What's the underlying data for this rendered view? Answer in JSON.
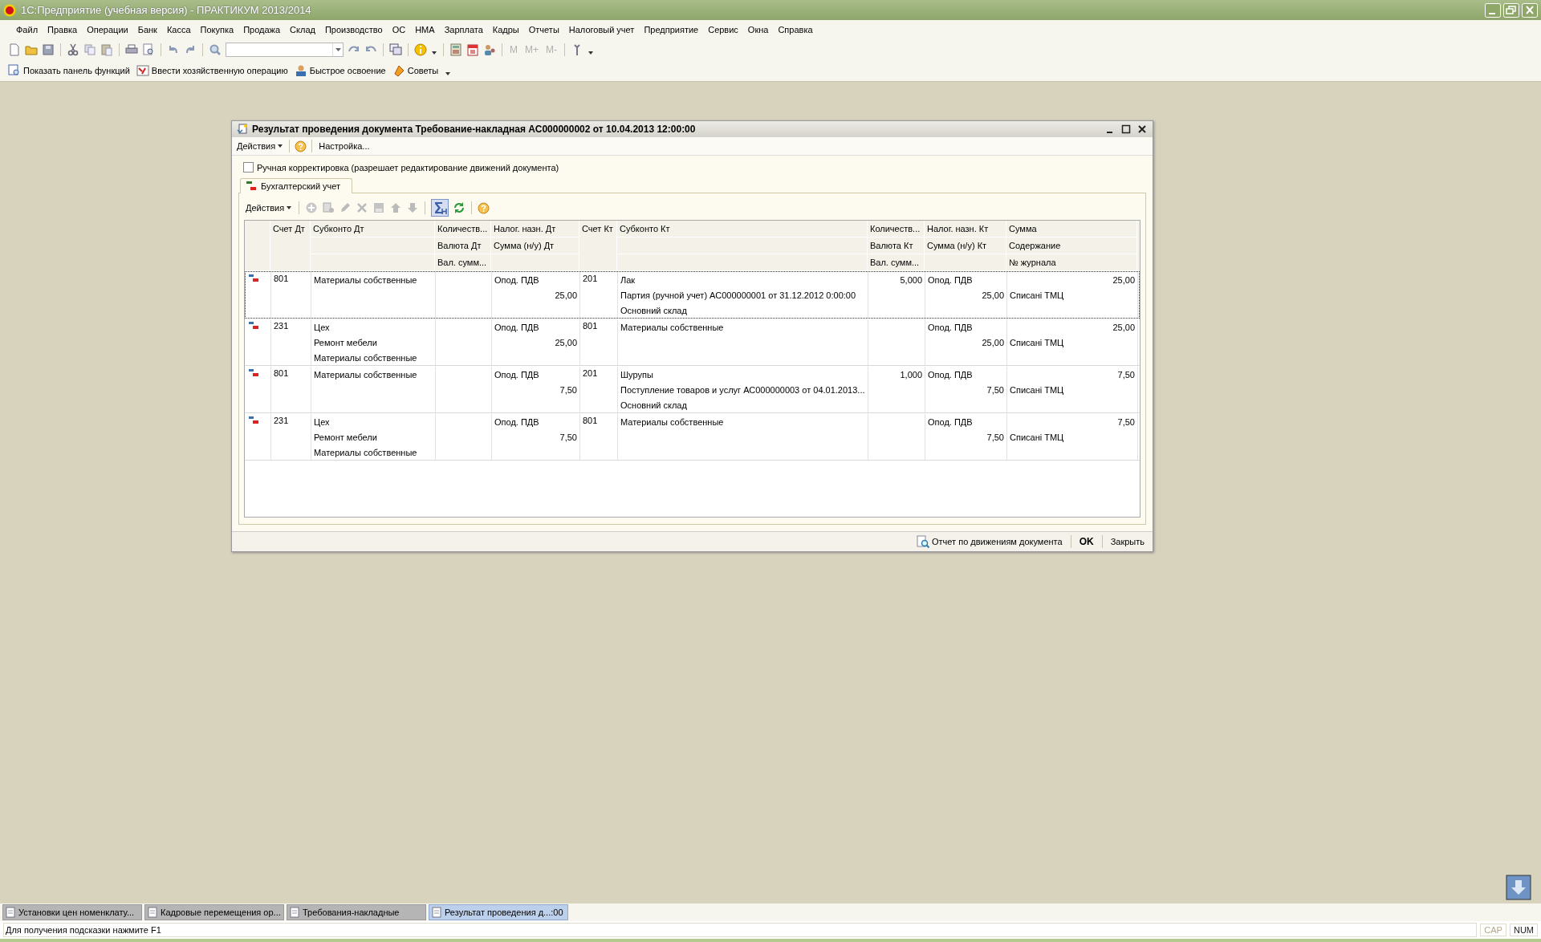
{
  "window": {
    "title": "1С:Предприятие (учебная версия) - ПРАКТИКУМ 2013/2014"
  },
  "menu": [
    "Файл",
    "Правка",
    "Операции",
    "Банк",
    "Касса",
    "Покупка",
    "Продажа",
    "Склад",
    "Производство",
    "ОС",
    "НМА",
    "Зарплата",
    "Кадры",
    "Отчеты",
    "Налоговый учет",
    "Предприятие",
    "Сервис",
    "Окна",
    "Справка"
  ],
  "toolbar": {
    "memory_buttons": [
      {
        "label": "M",
        "disabled": true
      },
      {
        "label": "M+",
        "disabled": true
      },
      {
        "label": "M-",
        "disabled": true
      }
    ]
  },
  "quick_bar": [
    "Показать панель функций",
    "Ввести хозяйственную операцию",
    "Быстрое освоение",
    "Советы"
  ],
  "dialog": {
    "title": "Результат проведения документа Требование-накладная АС000000002 от 10.04.2013 12:00:00",
    "menu": {
      "actions": "Действия",
      "settings": "Настройка..."
    },
    "manual_edit": {
      "label": "Ручная корректировка (разрешает редактирование движений документа)",
      "checked": false
    },
    "tabs": [
      {
        "label": "Бухгалтерский учет",
        "selected": true
      }
    ],
    "table_toolbar": {
      "actions": "Действия",
      "totals_on": true
    },
    "columns": [
      {
        "kind": "icon"
      },
      {
        "kind": "single",
        "lines": [
          "Счет Дт"
        ]
      },
      {
        "kind": "stacked",
        "lines": [
          "Субконто Дт"
        ]
      },
      {
        "kind": "stacked",
        "lines": [
          "Количеств...",
          "Валюта Дт",
          "Вал. сумм..."
        ]
      },
      {
        "kind": "stacked",
        "lines": [
          "Налог. назн. Дт",
          "Сумма (н/у) Дт"
        ]
      },
      {
        "kind": "single",
        "lines": [
          "Счет Кт"
        ]
      },
      {
        "kind": "stacked",
        "lines": [
          "Субконто Кт"
        ]
      },
      {
        "kind": "stacked",
        "lines": [
          "Количеств...",
          "Валюта Кт",
          "Вал. сумм..."
        ]
      },
      {
        "kind": "stacked",
        "lines": [
          "Налог. назн. Кт",
          "Сумма (н/у) Кт"
        ]
      },
      {
        "kind": "stacked",
        "lines": [
          "Сумма",
          "Содержание",
          "№ журнала"
        ]
      }
    ],
    "rows": [
      {
        "selected": true,
        "cells": {
          "account_dt": [
            "801"
          ],
          "subconto_dt": [
            "Материалы собственные"
          ],
          "tax_dt": [
            "Опод. ПДВ",
            "25,00"
          ],
          "account_kt": [
            "201"
          ],
          "subconto_kt": [
            "Лак",
            "Партия (ручной учет) АС000000001 от 31.12.2012 0:00:00",
            "Основний склад"
          ],
          "quantity_kt": [
            "5,000"
          ],
          "tax_kt": [
            "Опод. ПДВ",
            "25,00"
          ],
          "sum": [
            "25,00",
            "Списані ТМЦ"
          ]
        }
      },
      {
        "selected": false,
        "cells": {
          "account_dt": [
            "231"
          ],
          "subconto_dt": [
            "Цех",
            "Ремонт мебели",
            "Материалы собственные"
          ],
          "tax_dt": [
            "Опод. ПДВ",
            "25,00"
          ],
          "account_kt": [
            "801"
          ],
          "subconto_kt": [
            "Материалы собственные"
          ],
          "tax_kt": [
            "Опод. ПДВ",
            "25,00"
          ],
          "sum": [
            "25,00",
            "Списані ТМЦ"
          ]
        }
      },
      {
        "selected": false,
        "cells": {
          "account_dt": [
            "801"
          ],
          "subconto_dt": [
            "Материалы собственные"
          ],
          "tax_dt": [
            "Опод. ПДВ",
            "7,50"
          ],
          "account_kt": [
            "201"
          ],
          "subconto_kt": [
            "Шурупы",
            "Поступление товаров и услуг АС000000003 от 04.01.2013...",
            "Основний склад"
          ],
          "quantity_kt": [
            "1,000"
          ],
          "tax_kt": [
            "Опод. ПДВ",
            "7,50"
          ],
          "sum": [
            "7,50",
            "Списані ТМЦ"
          ]
        }
      },
      {
        "selected": false,
        "cells": {
          "account_dt": [
            "231"
          ],
          "subconto_dt": [
            "Цех",
            "Ремонт мебели",
            "Материалы собственные"
          ],
          "tax_dt": [
            "Опод. ПДВ",
            "7,50"
          ],
          "account_kt": [
            "801"
          ],
          "subconto_kt": [
            "Материалы собственные"
          ],
          "tax_kt": [
            "Опод. ПДВ",
            "7,50"
          ],
          "sum": [
            "7,50",
            "Списані ТМЦ"
          ]
        }
      }
    ],
    "footer_buttons": [
      {
        "label": "Отчет по движениям документа",
        "kind": "report"
      },
      {
        "label": "OK",
        "kind": "default"
      },
      {
        "label": "Закрыть",
        "kind": "plain"
      }
    ]
  },
  "taskbar": [
    {
      "label": "Установки цен номенклату...",
      "selected": false
    },
    {
      "label": "Кадровые перемещения ор...",
      "selected": false
    },
    {
      "label": "Требования-накладные",
      "selected": false
    },
    {
      "label": "Результат проведения д...:00",
      "selected": true
    }
  ],
  "status_bar": {
    "hint": "Для получения подсказки нажмите F1",
    "indicators": [
      {
        "label": "CAP",
        "on": false
      },
      {
        "label": "NUM",
        "on": true
      }
    ]
  }
}
